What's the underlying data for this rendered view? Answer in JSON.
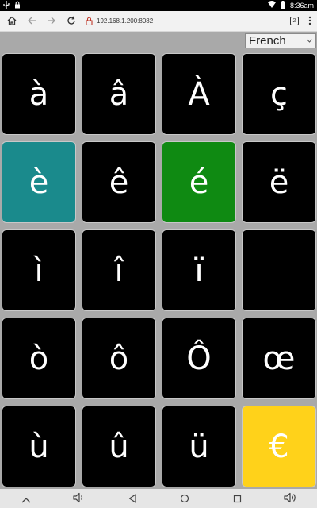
{
  "status_bar": {
    "time": "8:36",
    "am_pm": "am"
  },
  "browser": {
    "url": "192.168.1.200:8082",
    "tab_count": "2"
  },
  "language_select": {
    "selected": "French"
  },
  "colors": {
    "key_default": "#000000",
    "key_teal": "#1a8a8c",
    "key_green": "#0f8a12",
    "key_yellow": "#ffd21a",
    "background": "#a9a9a9"
  },
  "keys": [
    {
      "char": "à",
      "color": "#000000"
    },
    {
      "char": "â",
      "color": "#000000"
    },
    {
      "char": "À",
      "color": "#000000"
    },
    {
      "char": "ç",
      "color": "#000000"
    },
    {
      "char": "è",
      "color": "#1a8a8c"
    },
    {
      "char": "ê",
      "color": "#000000"
    },
    {
      "char": "é",
      "color": "#0f8a12"
    },
    {
      "char": "ë",
      "color": "#000000"
    },
    {
      "char": "ì",
      "color": "#000000"
    },
    {
      "char": "î",
      "color": "#000000"
    },
    {
      "char": "ï",
      "color": "#000000"
    },
    {
      "char": "",
      "color": "#000000"
    },
    {
      "char": "ò",
      "color": "#000000"
    },
    {
      "char": "ô",
      "color": "#000000"
    },
    {
      "char": "Ô",
      "color": "#000000"
    },
    {
      "char": "œ",
      "color": "#000000"
    },
    {
      "char": "ù",
      "color": "#000000"
    },
    {
      "char": "û",
      "color": "#000000"
    },
    {
      "char": "ü",
      "color": "#000000"
    },
    {
      "char": "€",
      "color": "#ffd21a"
    }
  ],
  "icons": {
    "status_left": [
      "usb-icon",
      "lock-icon"
    ],
    "status_right": [
      "wifi-icon",
      "battery-icon"
    ],
    "browser_nav": [
      "home-icon",
      "back-icon",
      "forward-icon",
      "reload-icon"
    ],
    "url_prefix": "insecure-lock-icon",
    "bottom_nav": [
      "hide-keyboard-icon",
      "volume-down-icon",
      "back-icon",
      "home-icon",
      "recents-icon",
      "volume-up-icon"
    ]
  }
}
